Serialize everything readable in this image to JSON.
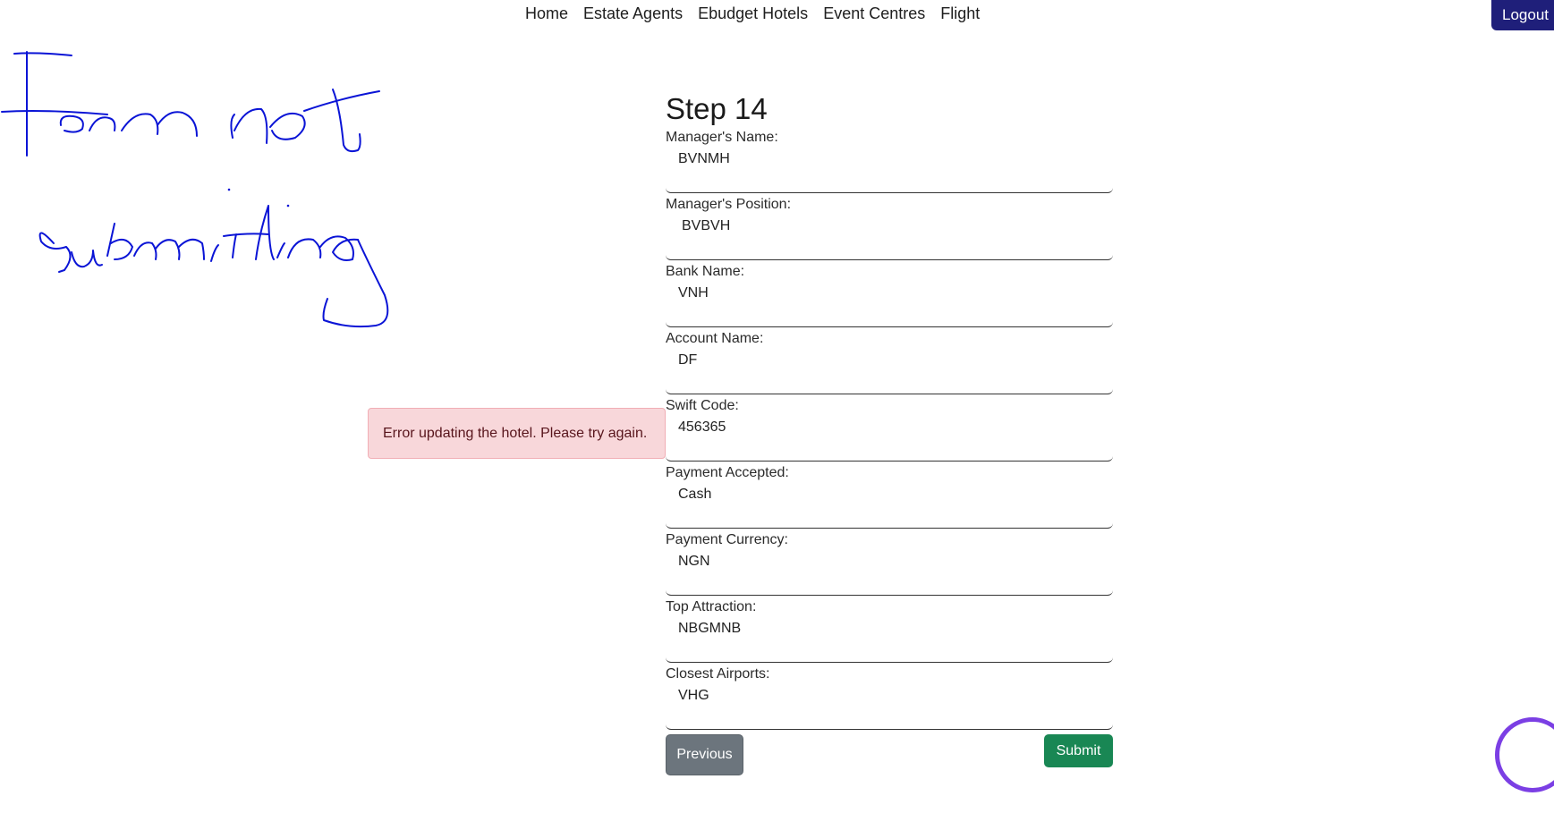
{
  "nav": {
    "links": [
      {
        "label": "Home"
      },
      {
        "label": "Estate Agents"
      },
      {
        "label": "Ebudget Hotels"
      },
      {
        "label": "Event Centres"
      },
      {
        "label": "Flight"
      }
    ],
    "logout_label": "Logout",
    "logout_color": "#1f1f7a"
  },
  "annotation": {
    "text": "Form not submitting",
    "color": "#0a14d6"
  },
  "alert": {
    "message": "Error updating the hotel. Please try again."
  },
  "form": {
    "step_title": "Step 14",
    "fields": [
      {
        "label": "Manager's Name:",
        "value": "BVNMH"
      },
      {
        "label": "Manager's Position:",
        "value": "BVBVH"
      },
      {
        "label": "Bank Name:",
        "value": "VNH"
      },
      {
        "label": "Account Name:",
        "value": "DF"
      },
      {
        "label": "Swift Code:",
        "value": "456365"
      },
      {
        "label": "Payment Accepted:",
        "value": "Cash"
      },
      {
        "label": "Payment Currency:",
        "value": "NGN"
      },
      {
        "label": "Top Attraction:",
        "value": "NBGMNB"
      },
      {
        "label": "Closest Airports:",
        "value": "VHG"
      }
    ],
    "previous_label": "Previous",
    "submit_label": "Submit",
    "submit_color": "#198754"
  },
  "chat": {
    "icon": "chat-bubble-icon",
    "color": "#7b3fe4"
  }
}
